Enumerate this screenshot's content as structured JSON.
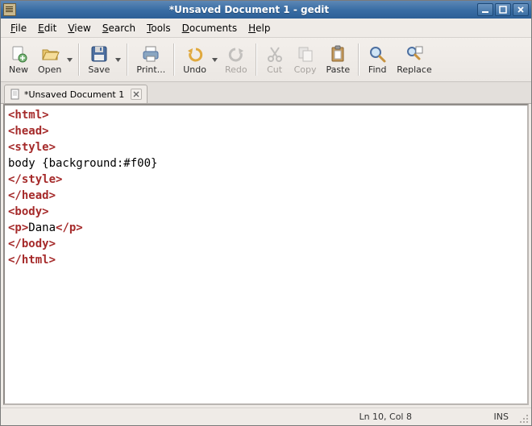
{
  "titlebar": {
    "title": "*Unsaved Document 1 - gedit"
  },
  "menu": {
    "file": "File",
    "edit": "Edit",
    "view": "View",
    "search": "Search",
    "tools": "Tools",
    "documents": "Documents",
    "help": "Help"
  },
  "toolbar": {
    "new": "New",
    "open": "Open",
    "save": "Save",
    "print": "Print...",
    "undo": "Undo",
    "redo": "Redo",
    "cut": "Cut",
    "copy": "Copy",
    "paste": "Paste",
    "find": "Find",
    "replace": "Replace"
  },
  "tab": {
    "label": "*Unsaved Document 1"
  },
  "editor": {
    "lines": [
      {
        "segments": [
          {
            "c": "tag",
            "t": "<html>"
          }
        ]
      },
      {
        "segments": [
          {
            "c": "tag",
            "t": "<head>"
          }
        ]
      },
      {
        "segments": [
          {
            "c": "tag",
            "t": "<style>"
          }
        ]
      },
      {
        "segments": [
          {
            "c": "",
            "t": "body {background:#f00}"
          }
        ]
      },
      {
        "segments": [
          {
            "c": "tag",
            "t": "</style>"
          }
        ]
      },
      {
        "segments": [
          {
            "c": "tag",
            "t": "</head>"
          }
        ]
      },
      {
        "segments": [
          {
            "c": "tag",
            "t": "<body>"
          }
        ]
      },
      {
        "segments": [
          {
            "c": "tag",
            "t": "<p>"
          },
          {
            "c": "",
            "t": "Dana"
          },
          {
            "c": "tag",
            "t": "</p>"
          }
        ]
      },
      {
        "segments": [
          {
            "c": "tag",
            "t": "</body>"
          }
        ]
      },
      {
        "segments": [
          {
            "c": "tag",
            "t": "</html>"
          }
        ]
      }
    ]
  },
  "status": {
    "pos": "  Ln 10, Col 8",
    "ins": "INS"
  }
}
